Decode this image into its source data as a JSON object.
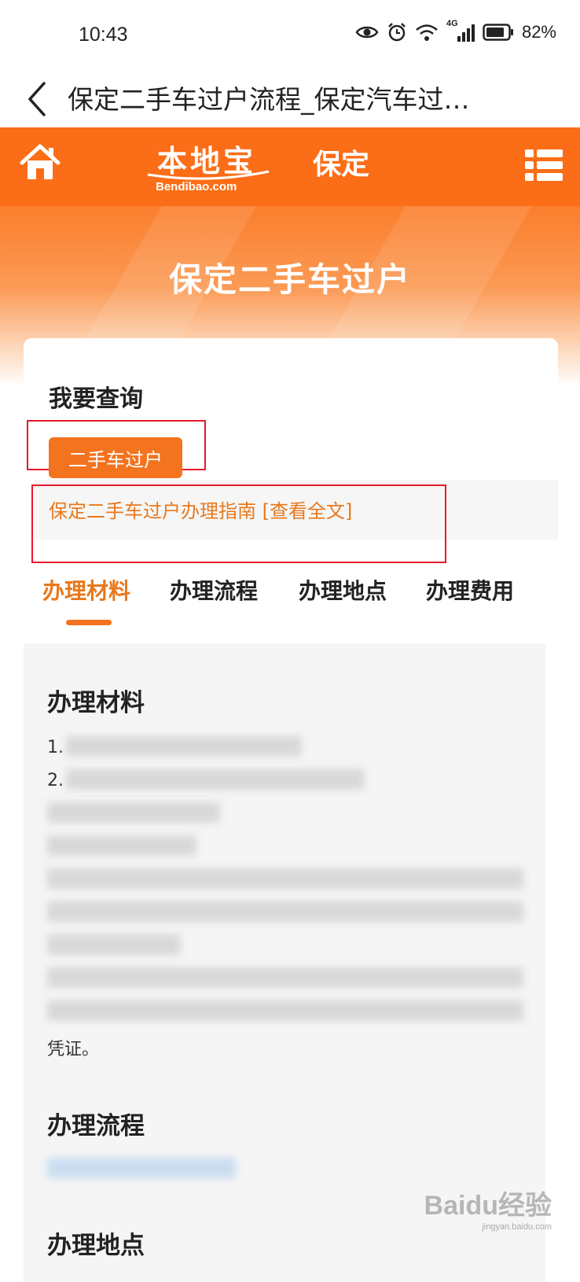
{
  "status_bar": {
    "time": "10:43",
    "network": "4G",
    "battery": "82%"
  },
  "title_bar": {
    "title": "保定二手车过户流程_保定汽车过…"
  },
  "header": {
    "logo_text": "本地宝",
    "logo_domain": "Bendibao.com",
    "city": "保定"
  },
  "banner": {
    "title": "保定二手车过户"
  },
  "card": {
    "query_label": "我要查询",
    "query_button": "二手车过户",
    "guide_link": "保定二手车过户办理指南 [查看全文]",
    "tabs": [
      "办理材料",
      "办理流程",
      "办理地点",
      "办理费用"
    ],
    "active_tab": "办理材料",
    "sections": {
      "materials_title": "办理材料",
      "materials_items": [
        "1.",
        "2.",
        "",
        "",
        "",
        "",
        "",
        "",
        "",
        "",
        "凭证。"
      ],
      "process_title": "办理流程",
      "location_title": "办理地点"
    }
  },
  "watermark": {
    "text": "Baidu经验",
    "sub": "jingyan.baidu.com"
  },
  "colors": {
    "brand_orange": "#fb6d16",
    "accent_orange": "#f3731e",
    "link_orange": "#e8781c",
    "annotation_red": "#e8182c"
  },
  "icons": [
    "eye-icon",
    "alarm-icon",
    "wifi-icon",
    "signal-icon",
    "battery-icon",
    "back-arrow-icon",
    "home-icon",
    "menu-icon"
  ]
}
